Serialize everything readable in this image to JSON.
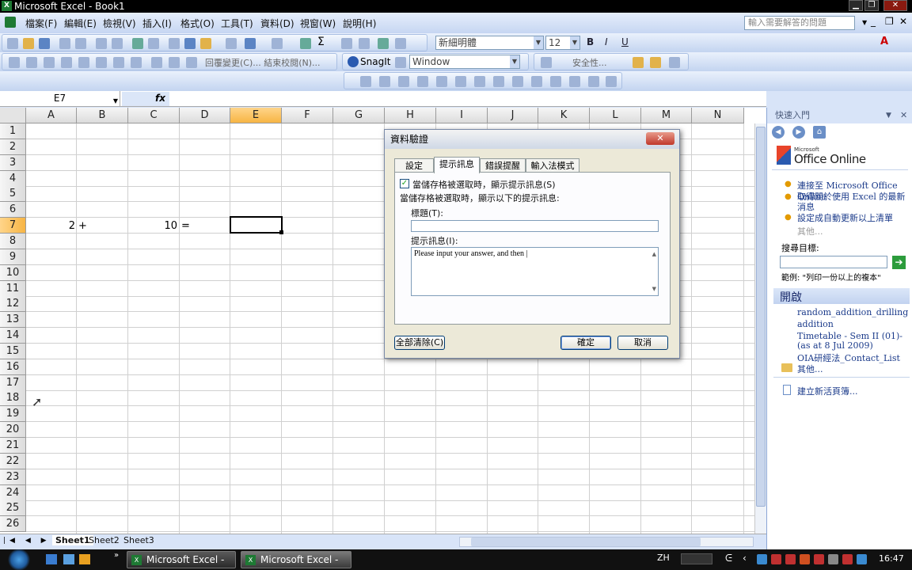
{
  "window": {
    "title": "Microsoft Excel - Book1",
    "min": "▁",
    "restore": "❐",
    "close": "✕"
  },
  "menu": {
    "items": [
      "檔案(F)",
      "編輯(E)",
      "檢視(V)",
      "插入(I)",
      "格式(O)",
      "工具(T)",
      "資料(D)",
      "視窗(W)",
      "說明(H)"
    ],
    "help_placeholder": "輸入需要解答的問題"
  },
  "toolbar": {
    "font_name": "新細明體",
    "font_size": "12",
    "bold": "B",
    "italic": "I",
    "underline": "U",
    "recognize_label": "回覆變更(C)...  結束校閱(N)...",
    "snagit_label": "SnagIt",
    "capture_mode": "Window",
    "security_label": "安全性..."
  },
  "formula_bar": {
    "name_box": "E7",
    "fx": "fx",
    "content": ""
  },
  "grid": {
    "columns": [
      "A",
      "B",
      "C",
      "D",
      "E",
      "F",
      "G",
      "H",
      "I",
      "J",
      "K",
      "L",
      "M",
      "N"
    ],
    "rows": [
      "1",
      "2",
      "3",
      "4",
      "5",
      "6",
      "7",
      "8",
      "9",
      "10",
      "11",
      "12",
      "13",
      "14",
      "15",
      "16",
      "17",
      "18",
      "19",
      "20",
      "21",
      "22",
      "23",
      "24",
      "25",
      "26"
    ],
    "selected_column": "E",
    "selected_row": "7",
    "cells": {
      "A7": "2",
      "B7": "+",
      "C7": "10",
      "D7": "="
    }
  },
  "sheet_tabs": [
    "Sheet1",
    "Sheet2",
    "Sheet3"
  ],
  "task_pane": {
    "title": "快速入門",
    "brand_small": "Microsoft",
    "brand": "Office Online",
    "links": [
      "連接至 Microsoft Office Online",
      "取得關於使用 Excel 的最新消息",
      "設定成自動更新以上清單"
    ],
    "more": "其他...",
    "search_label": "搜尋目標:",
    "example": "範例: \"列印一份以上的複本\"",
    "open_header": "開啟",
    "recent_files": [
      "random_addition_drilling",
      "addition",
      "Timetable - Sem II (01)-(as at 8 Jul 2009)",
      "OIA研經法_Contact_List"
    ],
    "open_more": "其他...",
    "new_workbook": "建立新活頁簿..."
  },
  "dialog": {
    "title": "資料驗證",
    "tabs": [
      "設定",
      "提示訊息",
      "錯誤提醒",
      "輸入法模式"
    ],
    "active_tab": "提示訊息",
    "checkbox_label": "當儲存格被選取時，顯示提示訊息(S)",
    "checkbox_checked": true,
    "section_label": "當儲存格被選取時，顯示以下的提示訊息:",
    "title_label": "標題(T):",
    "title_value": "",
    "message_label": "提示訊息(I):",
    "message_value": "Please input your answer, and then |",
    "clear_all": "全部清除(C)",
    "ok": "確定",
    "cancel": "取消"
  },
  "taskbar": {
    "tasks": [
      "Microsoft Excel - r...",
      "Microsoft Excel - B..."
    ],
    "lang": "ZH",
    "clock": "16:47"
  },
  "colors": {
    "accent": "#316ac5",
    "selected_header": "#f7b544",
    "link": "#1a3a8a"
  }
}
